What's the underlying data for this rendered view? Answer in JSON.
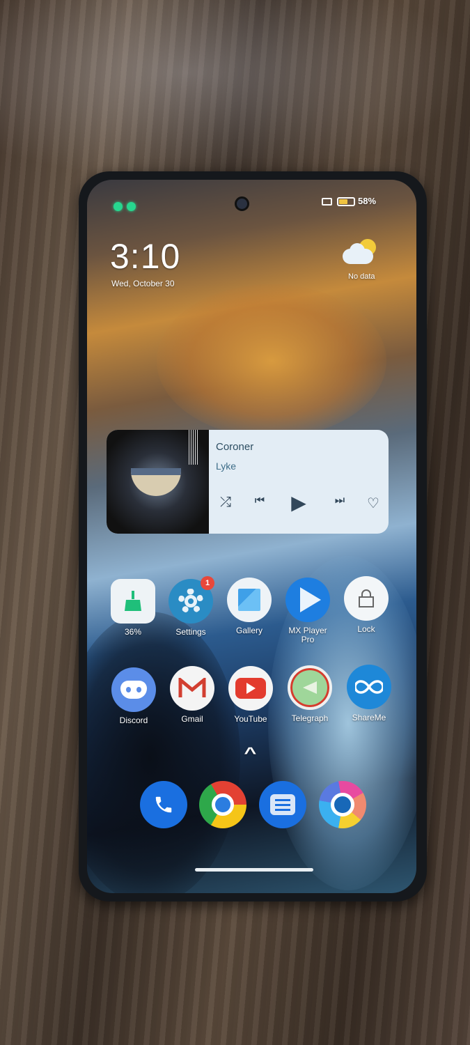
{
  "status_bar": {
    "battery_percent": "58%",
    "battery_level": 58,
    "icons": [
      "notification-dot-icon",
      "notification-dot-icon",
      "sim-icon",
      "battery-icon"
    ]
  },
  "clock": {
    "time": "3:10",
    "date": "Wed, October 30"
  },
  "weather": {
    "icon": "partly-cloudy-icon",
    "text": "No data"
  },
  "music_widget": {
    "title": "Coroner",
    "artist": "Lyke",
    "controls": {
      "shuffle": "⤮",
      "previous": "⏮",
      "play": "▶",
      "next": "⏭",
      "like": "♡"
    }
  },
  "apps_row1": [
    {
      "label": "36%",
      "icon": "cleaner-broom-icon"
    },
    {
      "label": "Settings",
      "icon": "gear-icon",
      "badge": "1"
    },
    {
      "label": "Gallery",
      "icon": "gallery-icon"
    },
    {
      "label": "MX Player Pro",
      "icon": "play-icon"
    },
    {
      "label": "Lock",
      "icon": "lock-icon"
    }
  ],
  "apps_row2": [
    {
      "label": "Discord",
      "icon": "discord-icon"
    },
    {
      "label": "Gmail",
      "icon": "gmail-icon"
    },
    {
      "label": "YouTube",
      "icon": "youtube-icon"
    },
    {
      "label": "Telegraph",
      "icon": "telegram-icon"
    },
    {
      "label": "ShareMe",
      "icon": "infinity-icon"
    }
  ],
  "app_drawer_hint": "^",
  "dock": [
    {
      "icon": "phone-icon"
    },
    {
      "icon": "chrome-icon"
    },
    {
      "icon": "messages-icon"
    },
    {
      "icon": "chrome-canary-icon"
    }
  ],
  "colors": {
    "accent_green": "#27d68f",
    "badge_red": "#e8483b",
    "widget_bg": "#e3edf5"
  }
}
